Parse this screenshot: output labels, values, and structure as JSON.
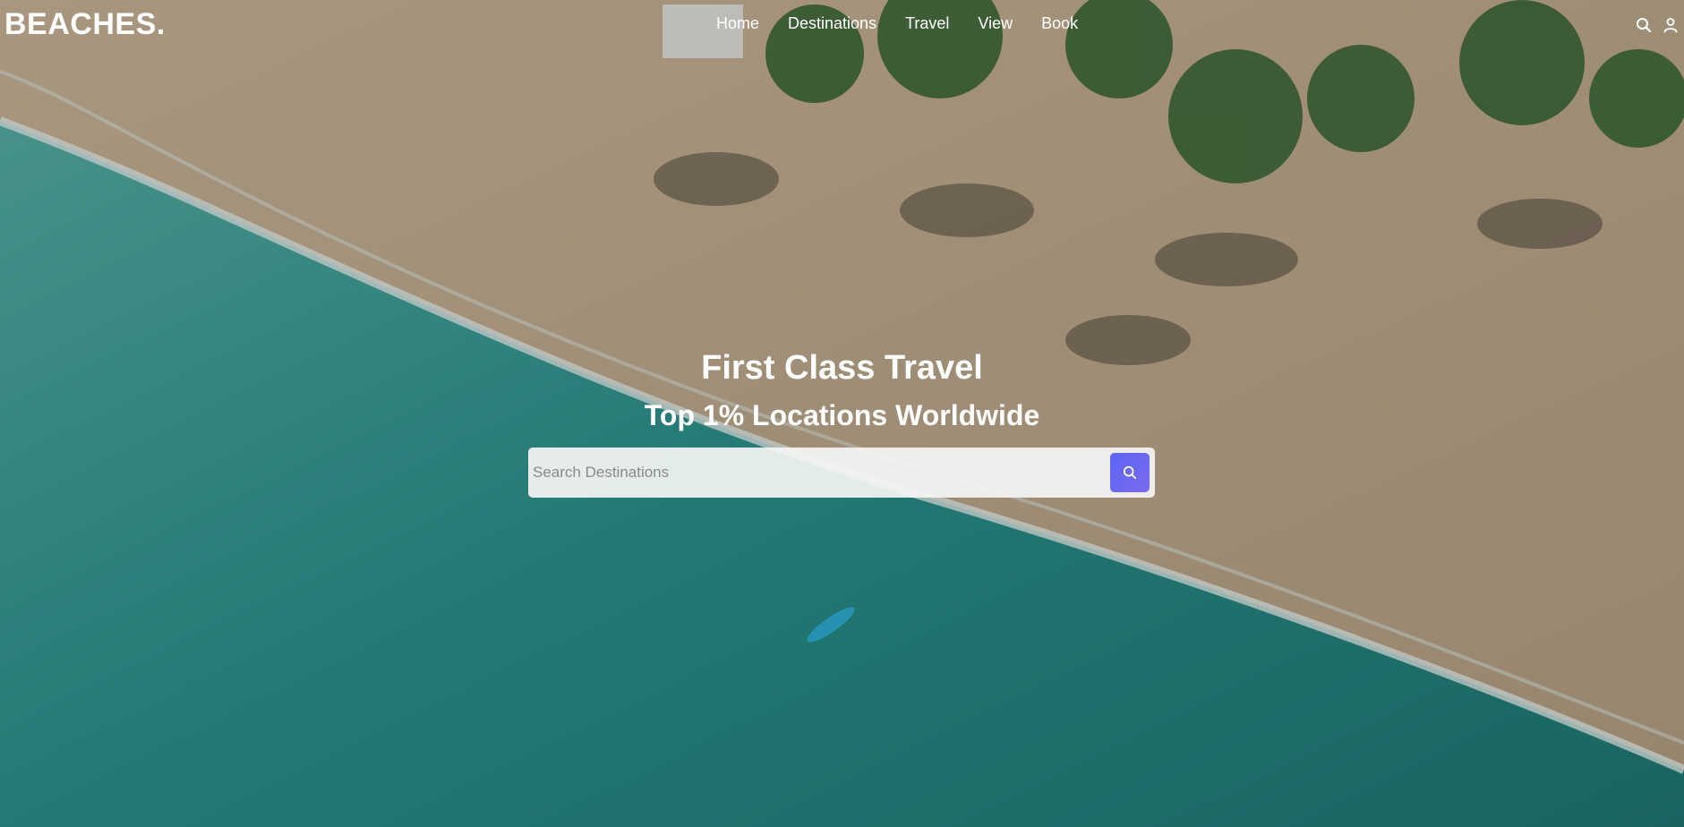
{
  "brand": {
    "logo": "BEACHES."
  },
  "nav": {
    "items": [
      {
        "label": "Home"
      },
      {
        "label": "Destinations"
      },
      {
        "label": "Travel"
      },
      {
        "label": "View"
      },
      {
        "label": "Book"
      }
    ],
    "icons": [
      "search-icon",
      "user-icon"
    ]
  },
  "hero": {
    "title": "First Class Travel",
    "subtitle": "Top 1% Locations Worldwide",
    "background": "aerial beach photo"
  },
  "search": {
    "placeholder": "Search Destinations",
    "value": "",
    "button_icon": "search-icon"
  },
  "colors": {
    "accent": "#5b63f5",
    "sand": "#d9c6a8",
    "water": "#2a9590"
  }
}
